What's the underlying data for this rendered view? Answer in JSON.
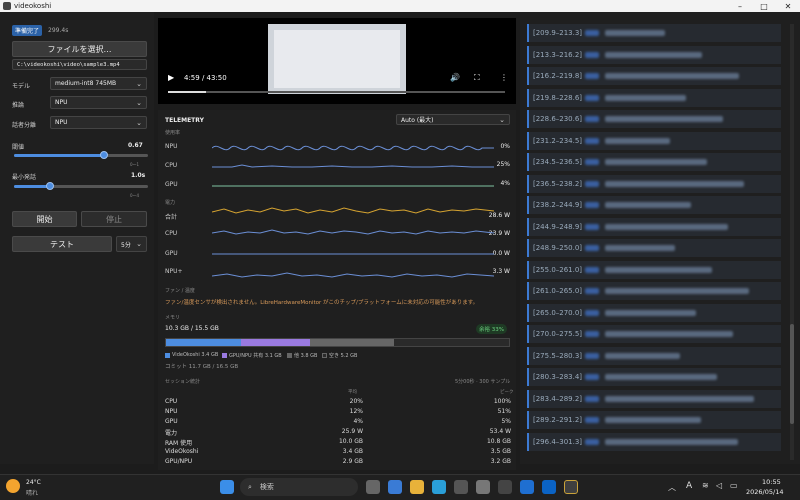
{
  "window": {
    "title": "videokoshi"
  },
  "left": {
    "status": "準備完了",
    "elapsed": "299.4s",
    "select_file": "ファイルを選択…",
    "file_path": "C:\\videokoshi\\video\\sample3.mp4",
    "model_label": "モデル",
    "model_value": "medium-int8 745MB",
    "infer_label": "推論",
    "infer_value": "NPU",
    "diar_label": "話者分離",
    "diar_value": "NPU",
    "thr_label": "閾値",
    "thr_value": "0.67",
    "thr_level": 0.67,
    "thr_range": "0〜1",
    "minseg_label": "最小発話",
    "minseg_value": "1.0s",
    "minseg_level": 0.27,
    "minseg_range": "0〜4",
    "start": "開始",
    "stop": "停止",
    "test": "テスト",
    "test_dur": "5分"
  },
  "video": {
    "time": "4:59 / 43:50",
    "progress": 0.114
  },
  "telemetry": {
    "title": "TELEMETRY",
    "mode": "Auto (最大)",
    "usage_label": "使用率",
    "usage": [
      {
        "name": "NPU",
        "value": "0%",
        "color": "#6b8fd6"
      },
      {
        "name": "CPU",
        "value": "25%",
        "color": "#6b8fd6"
      },
      {
        "name": "GPU",
        "value": "4%",
        "color": "#7fc3a0"
      }
    ],
    "power_label": "電力",
    "power": [
      {
        "name": "合計",
        "value": "28.6 W",
        "color": "#d6a431"
      },
      {
        "name": "CPU",
        "value": "23.9 W",
        "color": "#6b8fd6"
      },
      {
        "name": "GPU",
        "value": "0.0 W",
        "color": "#6b8fd6"
      },
      {
        "name": "NPU+",
        "value": "3.3 W",
        "color": "#6b8fd6"
      }
    ],
    "fan_label": "ファン / 温度",
    "fan_note": "ファン/温度センサが検出されません。LibreHardwareMonitor がこのチップ/プラットフォームに未対応の可能性があります。",
    "mem_label": "メモリ",
    "mem_total": "10.3 GB / 15.5 GB",
    "mem_free": "余裕 33%",
    "mem_legend": [
      {
        "name": "VideOkoshi 3.4 GB",
        "color": "#4d8de0"
      },
      {
        "name": "GPU/NPU 共有 3.1 GB",
        "color": "#9a7ae0"
      },
      {
        "name": "他 3.8 GB",
        "color": "#666666"
      },
      {
        "name": "空き 5.2 GB",
        "color": "#2a2a2a"
      }
    ],
    "mem_commit": "コミット 11.7 GB / 16.5 GB",
    "session_label": "セッション統計",
    "session_meta": "5分00秒 · 300 サンプル",
    "col_avg": "平均",
    "col_peak": "ピーク",
    "stats": [
      [
        "CPU",
        "20%",
        "100%"
      ],
      [
        "NPU",
        "12%",
        "51%"
      ],
      [
        "GPU",
        "4%",
        "5%"
      ],
      [
        "電力",
        "25.9 W",
        "53.4 W"
      ],
      [
        "RAM 使用",
        "10.0 GB",
        "10.8 GB"
      ],
      [
        "VideOkoshi",
        "3.4 GB",
        "3.5 GB"
      ],
      [
        "GPU/NPU",
        "2.9 GB",
        "3.2 GB"
      ]
    ]
  },
  "transcript": [
    "[209.9–213.3]",
    "[213.3–216.2]",
    "[216.2–219.8]",
    "[219.8–228.6]",
    "[228.6–230.6]",
    "[231.2–234.5]",
    "[234.5–236.5]",
    "[236.5–238.2]",
    "[238.2–244.9]",
    "[244.9–248.9]",
    "[248.9–250.0]",
    "[255.0–261.0]",
    "[261.0–265.0]",
    "[265.0–270.0]",
    "[270.0–275.5]",
    "[275.5–280.3]",
    "[280.3–283.4]",
    "[283.4–289.2]",
    "[289.2–291.2]",
    "[296.4–301.3]"
  ],
  "taskbar": {
    "temp": "24°C",
    "weather": "晴れ",
    "search": "検索",
    "ime": "A",
    "time": "10:55",
    "date": "2026/05/14"
  }
}
